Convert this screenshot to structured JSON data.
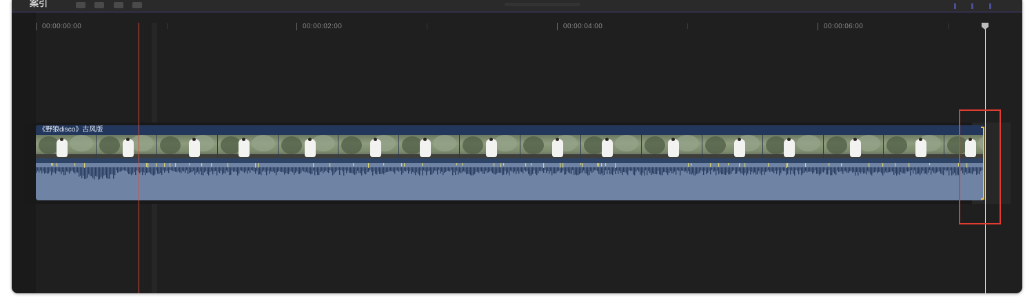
{
  "toolbar": {
    "title": "案引"
  },
  "ruler": {
    "timecodes": [
      "00:00:00:00",
      "00:00:02:00",
      "00:00:04:00",
      "00:00:06:00"
    ]
  },
  "clip": {
    "title": "《野狼disco》古风版",
    "frame_count": 16
  },
  "colors": {
    "background": "#1f1f1f",
    "clip_header": "#23375c",
    "audio": "#6f84a5",
    "playhead": "#d94d3a",
    "end_marker": "#f3c13a",
    "annotation_box": "#e23b2f"
  }
}
